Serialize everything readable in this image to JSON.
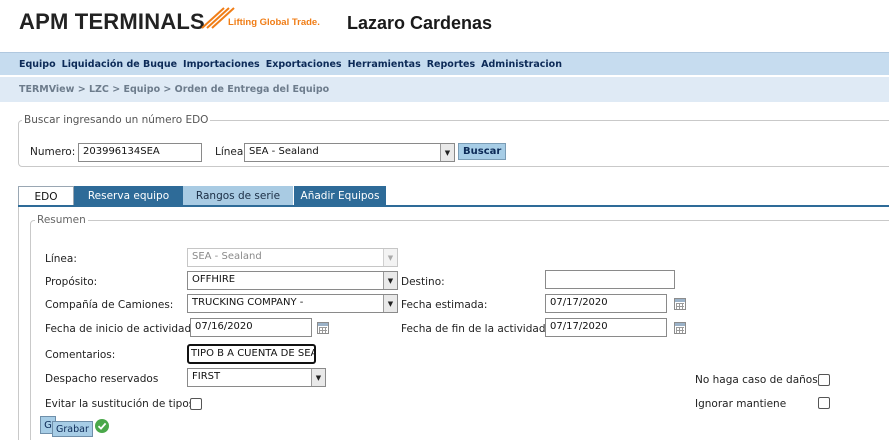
{
  "header": {
    "logo_text": "APM TERMINALS",
    "logo_tagline": "Lifting Global Trade.",
    "site_title": "Lazaro Cardenas",
    "brand_color": "#f07d16"
  },
  "menu": {
    "items": [
      "Equipo",
      "Liquidación de Buque",
      "Importaciones",
      "Exportaciones",
      "Herramientas",
      "Reportes",
      "Administracion"
    ]
  },
  "breadcrumb": "TERMView > LZC > Equipo > Orden de Entrega del Equipo",
  "search": {
    "legend": "Buscar ingresando un número EDO",
    "numero_label": "Numero:",
    "numero_value": "203996134SEA",
    "linea_label": "Línea:",
    "linea_value": "SEA - Sealand",
    "buscar_label": "Buscar"
  },
  "tabs": [
    {
      "label": "EDO"
    },
    {
      "label": "Reserva equipo"
    },
    {
      "label": "Rangos de serie"
    },
    {
      "label": "Añadir Equipos"
    }
  ],
  "form": {
    "legend": "Resumen",
    "linea_label": "Línea:",
    "linea_value": "SEA - Sealand",
    "proposito_label": "Propósito:",
    "proposito_value": "OFFHIRE",
    "destino_label": "Destino:",
    "destino_value": "",
    "compania_label": "Compañía de Camiones:",
    "compania_value": "TRUCKING COMPANY -",
    "fecha_estimada_label": "Fecha estimada:",
    "fecha_estimada_value": "07/17/2020",
    "fecha_inicio_label": "Fecha de inicio de actividad:",
    "fecha_inicio_value": "07/16/2020",
    "fecha_fin_label": "Fecha de fin de la actividad:",
    "fecha_fin_value": "07/17/2020",
    "comentarios_label": "Comentarios:",
    "comentarios_value": "TIPO B A CUENTA DE SEA",
    "despacho_label": "Despacho reservados",
    "despacho_value": "FIRST",
    "evitar_label": "Evitar la sustitución de tipos",
    "no_haga_label": "No haga caso de daños",
    "ignorar_label": "Ignorar mantiene"
  },
  "actions": {
    "g_label": "G",
    "grabar_label": "Grabar"
  }
}
